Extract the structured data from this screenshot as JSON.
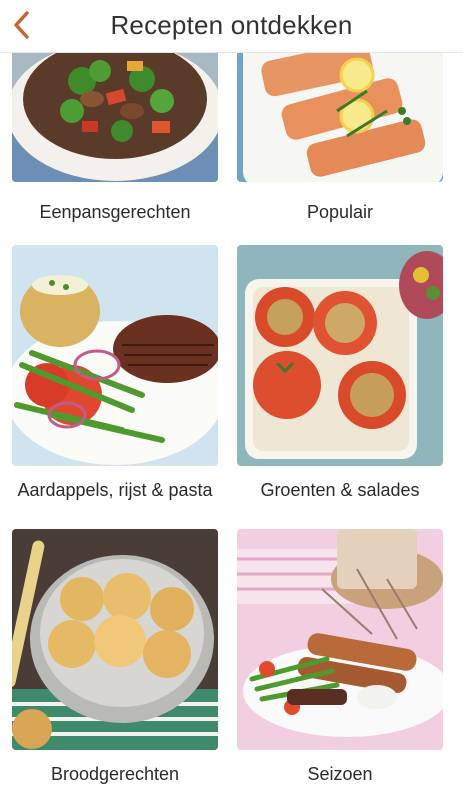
{
  "header": {
    "title": "Recepten ontdekken",
    "back_icon": "chevron-left-icon",
    "accent_color": "#c8622f"
  },
  "categories": [
    {
      "label": "Eenpansgerechten"
    },
    {
      "label": "Populair"
    },
    {
      "label": "Aardappels, rijst & pasta"
    },
    {
      "label": "Groenten & salades"
    },
    {
      "label": "Broodgerechten"
    },
    {
      "label": "Seizoen"
    }
  ]
}
